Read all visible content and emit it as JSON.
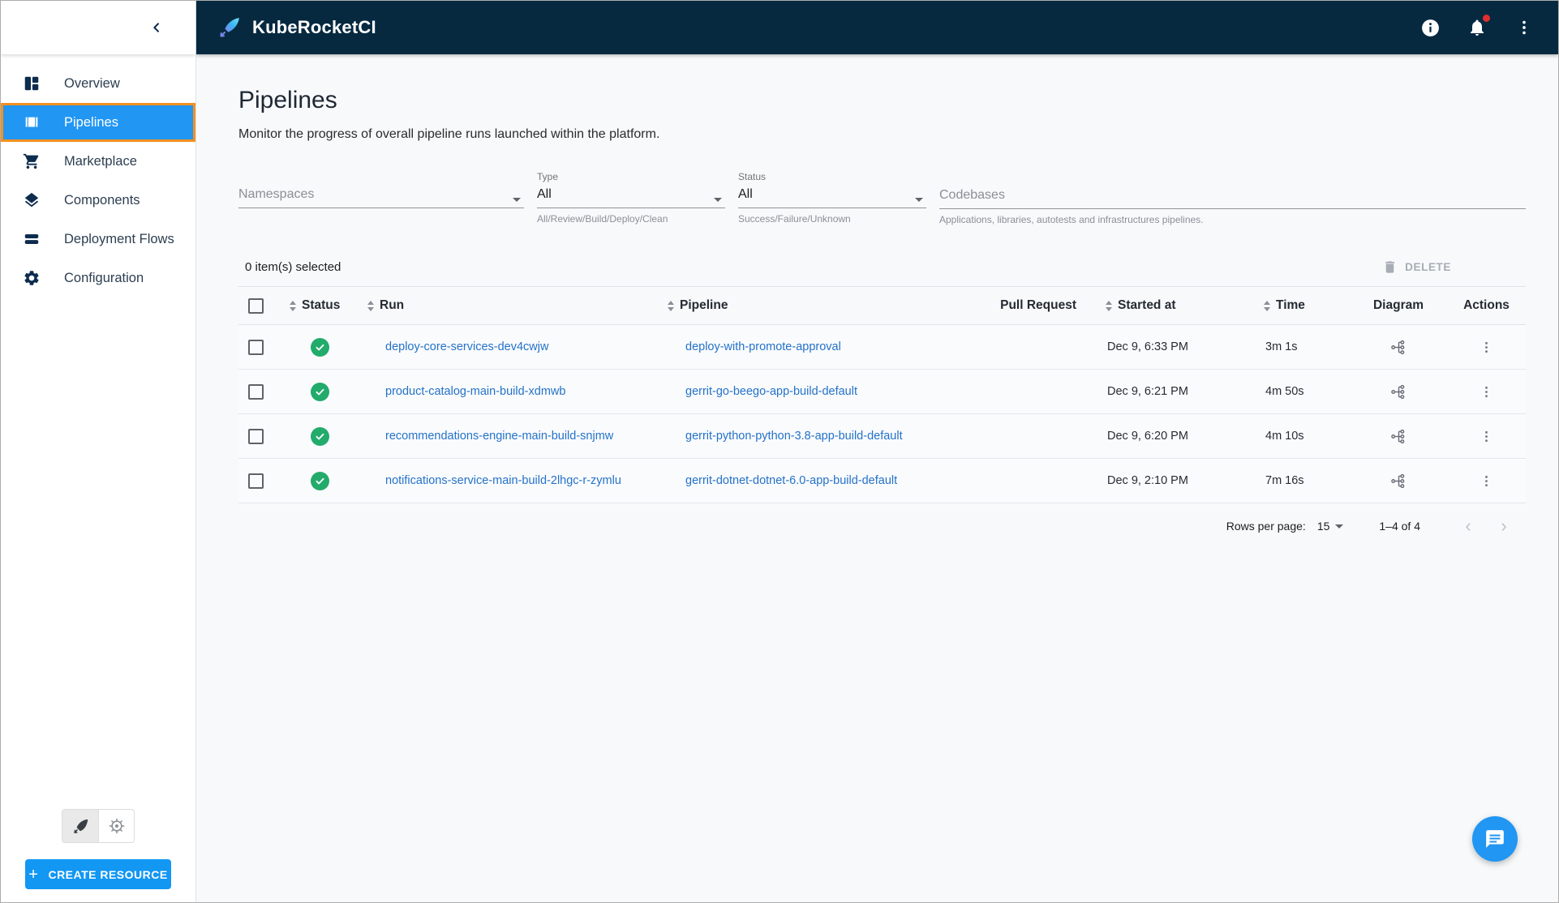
{
  "header": {
    "app_name": "KubeRocketCI",
    "icons": [
      "info-icon",
      "notifications-icon",
      "kebab-menu-icon"
    ],
    "notification_badge": true
  },
  "sidebar": {
    "items": [
      {
        "label": "Overview",
        "icon": "overview-icon",
        "selected": false
      },
      {
        "label": "Pipelines",
        "icon": "pipelines-icon",
        "selected": true
      },
      {
        "label": "Marketplace",
        "icon": "marketplace-cart-icon",
        "selected": false
      },
      {
        "label": "Components",
        "icon": "components-layers-icon",
        "selected": false
      },
      {
        "label": "Deployment Flows",
        "icon": "deployment-flows-icon",
        "selected": false
      },
      {
        "label": "Configuration",
        "icon": "configuration-gear-icon",
        "selected": false
      }
    ],
    "footer_toggles": [
      "rocket-view-toggle",
      "kubernetes-view-toggle"
    ],
    "create_button_label": "CREATE RESOURCE"
  },
  "page": {
    "title": "Pipelines",
    "subtitle": "Monitor the progress of overall pipeline runs launched within the platform."
  },
  "filters": {
    "namespaces": {
      "placeholder": "Namespaces"
    },
    "type": {
      "label": "Type",
      "value": "All",
      "helper": "All/Review/Build/Deploy/Clean"
    },
    "status": {
      "label": "Status",
      "value": "All",
      "helper": "Success/Failure/Unknown"
    },
    "codebases": {
      "placeholder": "Codebases",
      "helper": "Applications, libraries, autotests and infrastructures pipelines."
    }
  },
  "table": {
    "selected_text": "0 item(s) selected",
    "delete_label": "DELETE",
    "columns": {
      "status": "Status",
      "run": "Run",
      "pipeline": "Pipeline",
      "pull_request": "Pull Request",
      "started_at": "Started at",
      "time": "Time",
      "diagram": "Diagram",
      "actions": "Actions"
    },
    "rows": [
      {
        "status": "success",
        "run": "deploy-core-services-dev4cwjw",
        "pipeline": "deploy-with-promote-approval",
        "started_at": "Dec 9, 6:33 PM",
        "time": "3m 1s"
      },
      {
        "status": "success",
        "run": "product-catalog-main-build-xdmwb",
        "pipeline": "gerrit-go-beego-app-build-default",
        "started_at": "Dec 9, 6:21 PM",
        "time": "4m 50s"
      },
      {
        "status": "success",
        "run": "recommendations-engine-main-build-snjmw",
        "pipeline": "gerrit-python-python-3.8-app-build-default",
        "started_at": "Dec 9, 6:20 PM",
        "time": "4m 10s"
      },
      {
        "status": "success",
        "run": "notifications-service-main-build-2lhgc-r-zymlu",
        "pipeline": "gerrit-dotnet-dotnet-6.0-app-build-default",
        "started_at": "Dec 9, 2:10 PM",
        "time": "7m 16s"
      }
    ],
    "pagination": {
      "rows_per_page_label": "Rows per page:",
      "rows_per_page_value": "15",
      "range_text": "1–4 of 4",
      "prev": "‹",
      "next": "›"
    }
  },
  "colors": {
    "appbar_bg": "#062940",
    "selected_item_bg": "#2196f3",
    "selected_item_border": "#f29120",
    "success_green": "#22ab6b",
    "link_blue": "#2472c8",
    "primary_button": "#1297f3",
    "content_bg": "#f7f9fb",
    "notification_dot": "#e02f2f"
  }
}
